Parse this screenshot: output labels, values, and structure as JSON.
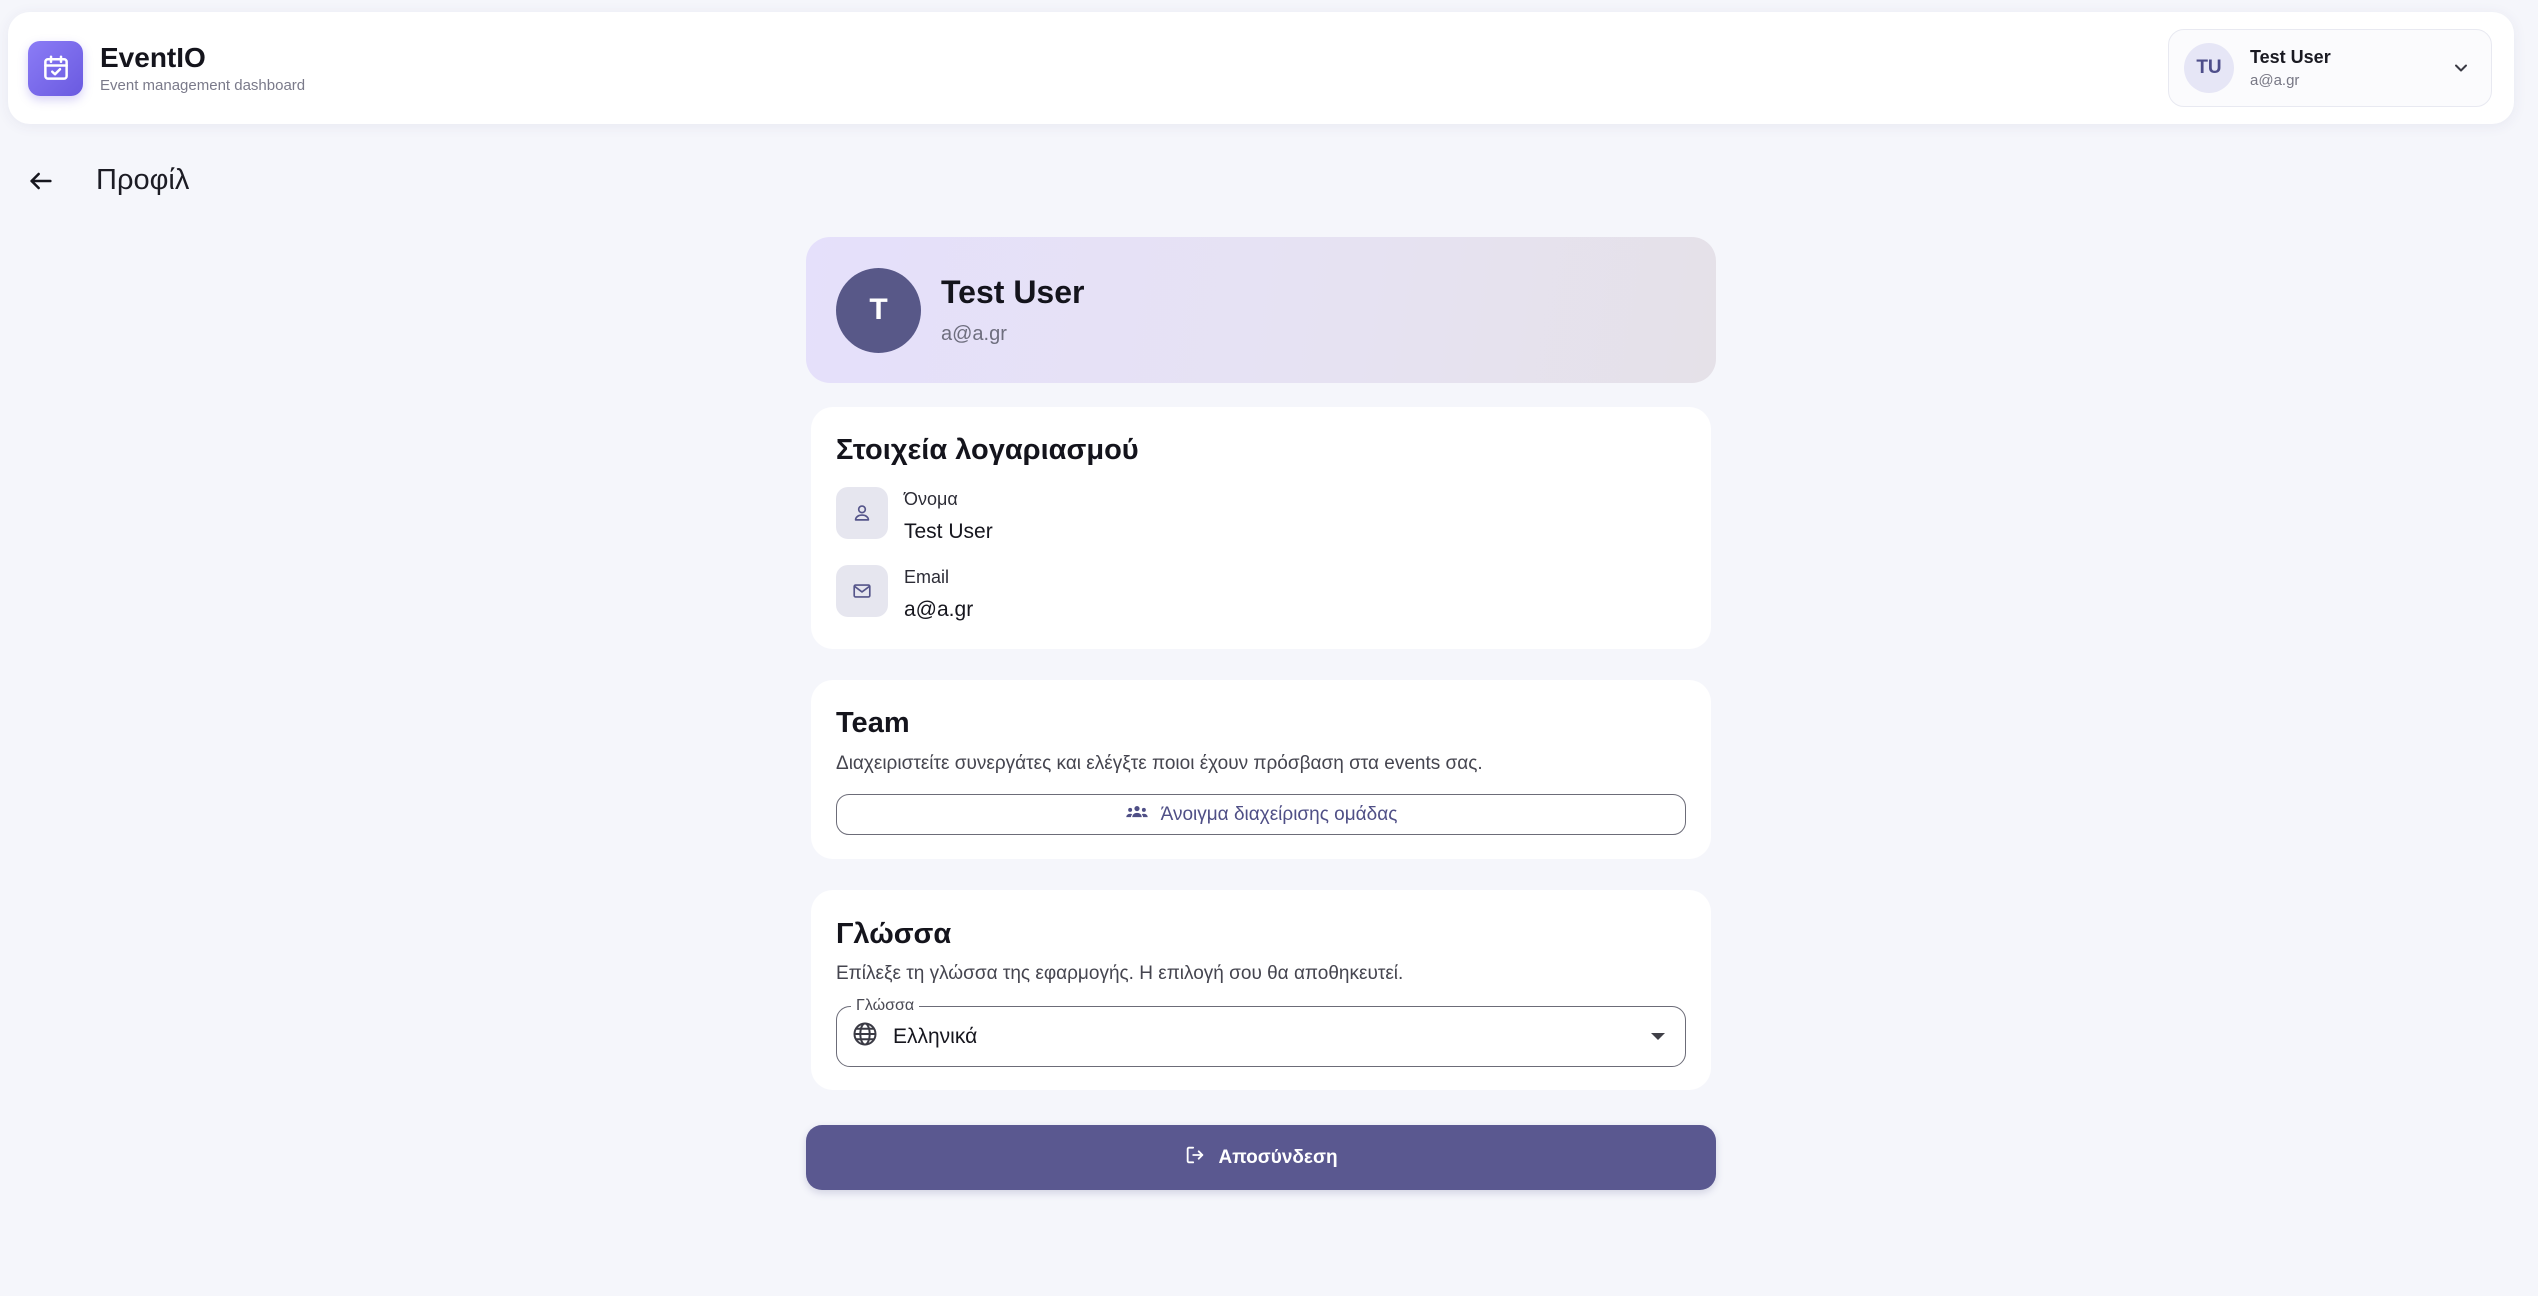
{
  "app": {
    "name": "EventIO",
    "subtitle": "Event management dashboard",
    "icon": "calendar-check-icon",
    "accent": "#7665eb"
  },
  "user_menu": {
    "initials": "TU",
    "name": "Test User",
    "email": "a@a.gr",
    "icon": "chevron-down-icon"
  },
  "page": {
    "title": "Προφίλ",
    "back_icon": "arrow-left-icon"
  },
  "profile": {
    "avatar_letter": "T",
    "name": "Test User",
    "email": "a@a.gr",
    "avatar_color": "#585888"
  },
  "account": {
    "title": "Στοιχεία λογαριασμού",
    "rows": [
      {
        "icon": "person-icon",
        "label": "Όνομα",
        "value": "Test User"
      },
      {
        "icon": "mail-icon",
        "label": "Email",
        "value": "a@a.gr"
      }
    ]
  },
  "team": {
    "title": "Team",
    "description": "Διαχειριστείτε συνεργάτες και ελέγξτε ποιοι έχουν πρόσβαση στα events σας.",
    "button_label": "Άνοιγμα διαχείρισης ομάδας",
    "button_icon": "group-icon"
  },
  "language": {
    "title": "Γλώσσα",
    "description": "Επίλεξε τη γλώσσα της εφαρμογής. Η επιλογή σου θα αποθηκευτεί.",
    "field_label": "Γλώσσα",
    "selected": "Ελληνικά",
    "icon": "globe-icon"
  },
  "logout": {
    "label": "Αποσύνδεση",
    "icon": "logout-icon",
    "color": "#5a5890"
  }
}
